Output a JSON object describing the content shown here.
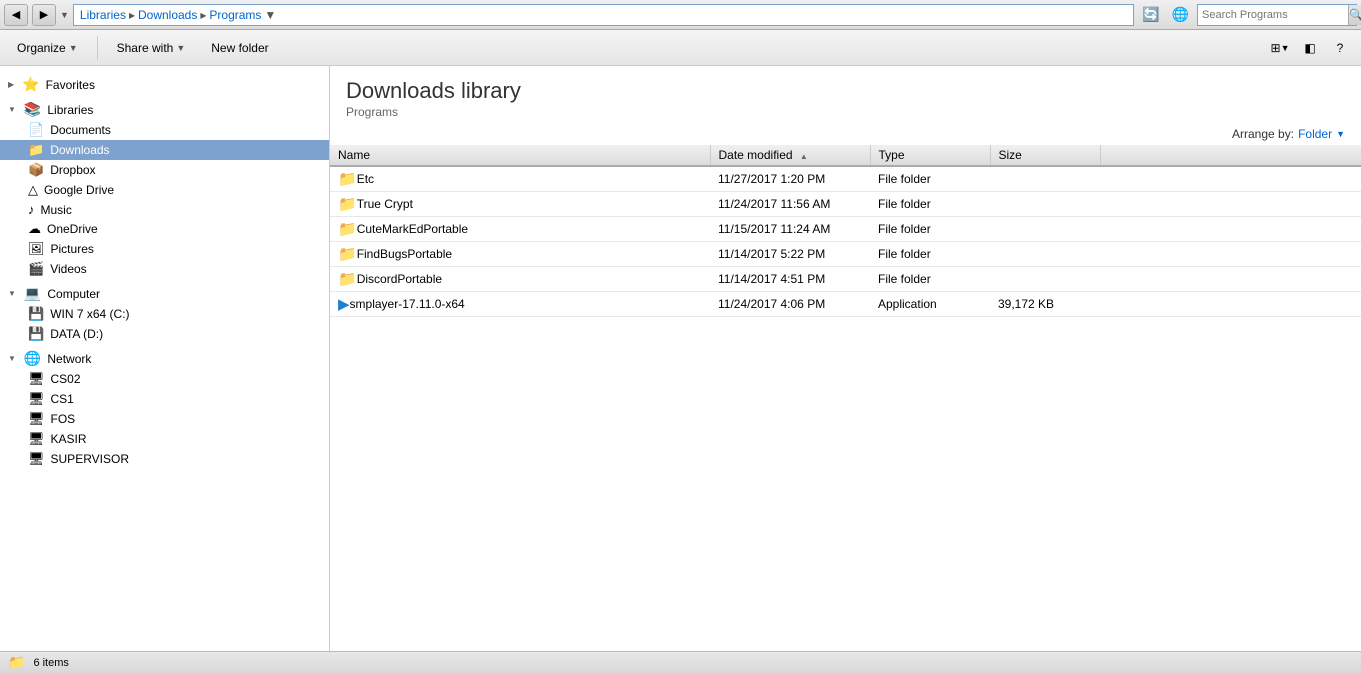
{
  "addressBar": {
    "backLabel": "◀",
    "forwardLabel": "▶",
    "dropdownLabel": "▼",
    "path": "Libraries ▸ Downloads ▸ Programs",
    "pathParts": [
      "Libraries",
      "Downloads",
      "Programs"
    ],
    "searchPlaceholder": "Search Programs",
    "searchLabel": "Search Programs",
    "refreshIcon": "🔄",
    "compatIcon": "🌐"
  },
  "toolbar": {
    "organizeLabel": "Organize",
    "shareWithLabel": "Share with",
    "newFolderLabel": "New folder",
    "viewIcon": "⊞",
    "previewIcon": "◧",
    "helpIcon": "?"
  },
  "sidebar": {
    "favorites": {
      "label": "Favorites",
      "icon": "⭐",
      "items": [
        {
          "id": "favorites",
          "label": "Favorites",
          "icon": "⭐",
          "isGroup": true
        },
        {
          "id": "libraries",
          "label": "Libraries",
          "icon": "📚",
          "isGroup": true
        },
        {
          "id": "documents",
          "label": "Documents",
          "icon": "📄"
        },
        {
          "id": "downloads",
          "label": "Downloads",
          "icon": "📁",
          "selected": true
        },
        {
          "id": "dropbox",
          "label": "Dropbox",
          "icon": "📦"
        },
        {
          "id": "google-drive",
          "label": "Google Drive",
          "icon": "△"
        },
        {
          "id": "music",
          "label": "Music",
          "icon": "♪"
        },
        {
          "id": "onedrive",
          "label": "OneDrive",
          "icon": "☁"
        },
        {
          "id": "pictures",
          "label": "Pictures",
          "icon": "🖼"
        },
        {
          "id": "videos",
          "label": "Videos",
          "icon": "🎬"
        },
        {
          "id": "computer",
          "label": "Computer",
          "icon": "💻",
          "isGroup": true
        },
        {
          "id": "win7",
          "label": "WIN 7 x64 (C:)",
          "icon": "💾"
        },
        {
          "id": "data-d",
          "label": "DATA (D:)",
          "icon": "💾"
        },
        {
          "id": "network",
          "label": "Network",
          "icon": "🌐",
          "isGroup": true
        },
        {
          "id": "cs02",
          "label": "CS02",
          "icon": "🖥"
        },
        {
          "id": "cs1",
          "label": "CS1",
          "icon": "🖥"
        },
        {
          "id": "fos",
          "label": "FOS",
          "icon": "🖥"
        },
        {
          "id": "kasir",
          "label": "KASIR",
          "icon": "🖥"
        },
        {
          "id": "supervisor",
          "label": "SUPERVISOR",
          "icon": "🖥"
        }
      ]
    }
  },
  "content": {
    "title": "Downloads library",
    "subtitle": "Programs",
    "arrangeBy": "Arrange by:",
    "arrangeValue": "Folder",
    "columns": {
      "name": "Name",
      "dateModified": "Date modified",
      "type": "Type",
      "size": "Size"
    },
    "files": [
      {
        "id": "etc",
        "name": "Etc",
        "icon": "📁",
        "dateModified": "11/27/2017 1:20 PM",
        "type": "File folder",
        "size": "",
        "isFolder": true
      },
      {
        "id": "truecrypt",
        "name": "True Crypt",
        "icon": "📁",
        "dateModified": "11/24/2017 11:56 AM",
        "type": "File folder",
        "size": "",
        "isFolder": true
      },
      {
        "id": "cutemarkportable",
        "name": "CuteMarkEdPortable",
        "icon": "📁",
        "dateModified": "11/15/2017 11:24 AM",
        "type": "File folder",
        "size": "",
        "isFolder": true
      },
      {
        "id": "findbugsportable",
        "name": "FindBugsPortable",
        "icon": "📁",
        "dateModified": "11/14/2017 5:22 PM",
        "type": "File folder",
        "size": "",
        "isFolder": true
      },
      {
        "id": "discordportable",
        "name": "DiscordPortable",
        "icon": "📁",
        "dateModified": "11/14/2017 4:51 PM",
        "type": "File folder",
        "size": "",
        "isFolder": true
      },
      {
        "id": "smplayer",
        "name": "smplayer-17.11.0-x64",
        "icon": "▶",
        "dateModified": "11/24/2017 4:06 PM",
        "type": "Application",
        "size": "39,172 KB",
        "isFolder": false
      }
    ]
  },
  "statusBar": {
    "itemCount": "6 items",
    "icon": "📁"
  }
}
